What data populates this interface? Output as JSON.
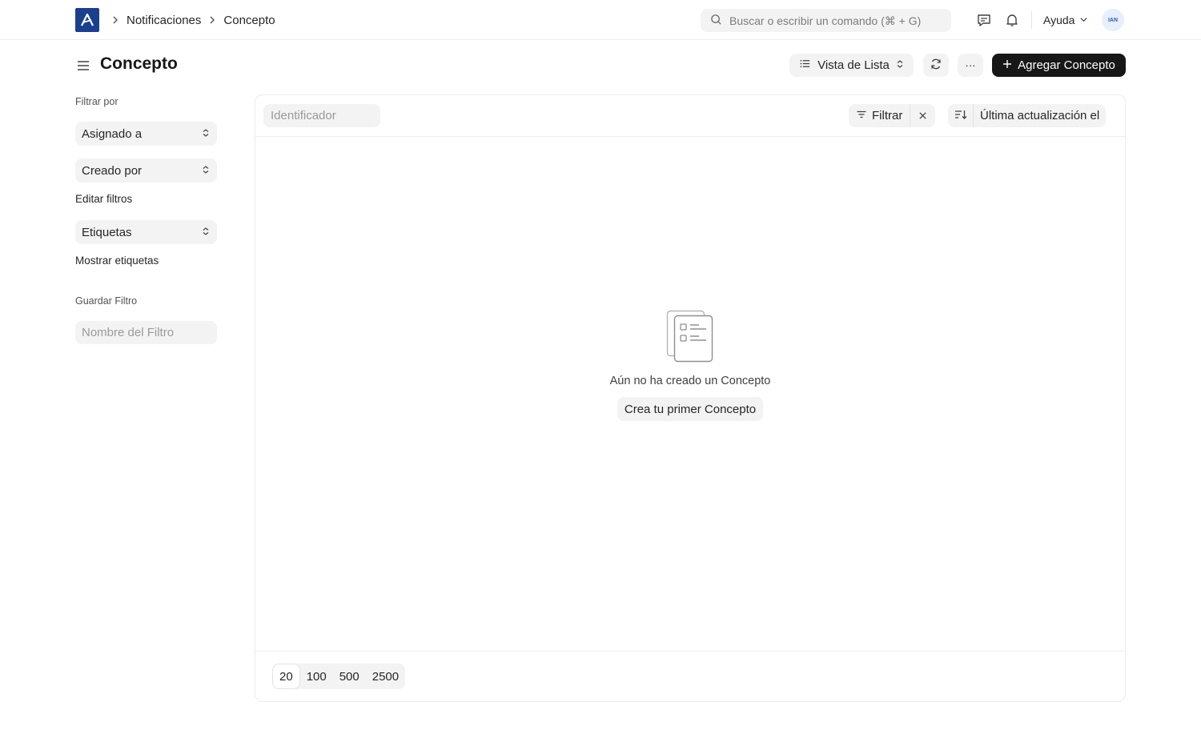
{
  "navbar": {
    "breadcrumbs": [
      "Notificaciones",
      "Concepto"
    ],
    "search_placeholder": "Buscar o escribir un comando (⌘ + G)",
    "help_label": "Ayuda",
    "avatar_initials": "IAN"
  },
  "page": {
    "title": "Concepto",
    "view_label": "Vista de Lista",
    "more_label": "···",
    "add_label": "Agregar Concepto"
  },
  "sidebar": {
    "filter_by_label": "Filtrar por",
    "assigned_to": "Asignado a",
    "created_by": "Creado por",
    "edit_filters": "Editar filtros",
    "tags": "Etiquetas",
    "show_tags": "Mostrar etiquetas",
    "save_filter_label": "Guardar Filtro",
    "filter_name_placeholder": "Nombre del Filtro"
  },
  "list": {
    "id_placeholder": "Identificador",
    "filter_label": "Filtrar",
    "sort_label": "Última actualización el",
    "empty_message": "Aún no ha creado un Concepto",
    "empty_button": "Crea tu primer Concepto",
    "page_sizes": [
      "20",
      "100",
      "500",
      "2500"
    ],
    "active_page_size": "20"
  },
  "colors": {
    "brand": "#1b3f8f",
    "primary_button": "#171717",
    "control_bg": "#f3f3f3"
  }
}
